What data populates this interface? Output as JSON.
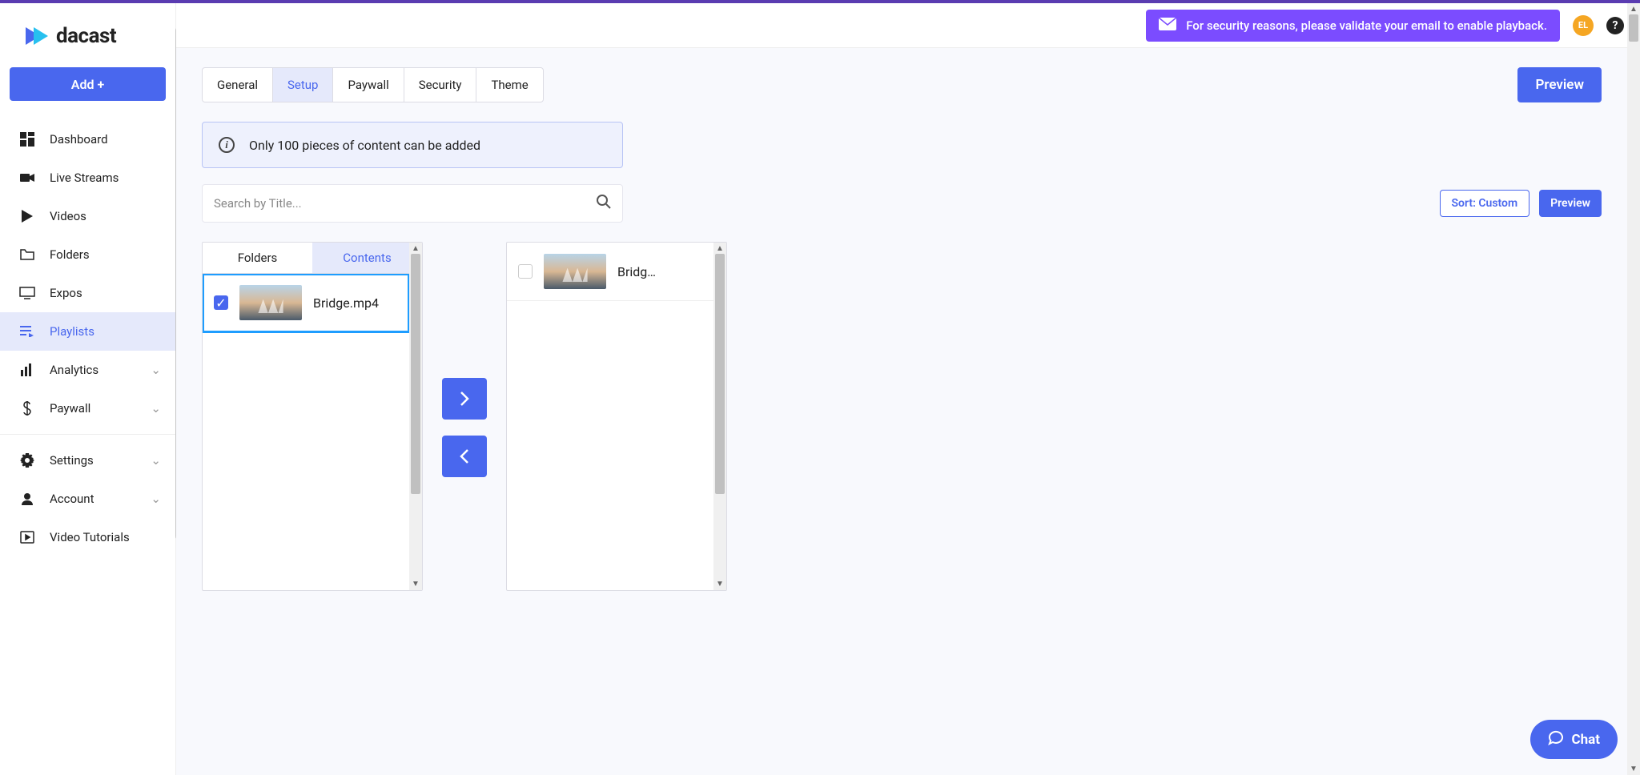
{
  "brand": {
    "name": "dacast"
  },
  "sidebar": {
    "add_label": "Add +",
    "items": [
      {
        "label": "Dashboard",
        "icon": "dashboard-icon"
      },
      {
        "label": "Live Streams",
        "icon": "camera-icon"
      },
      {
        "label": "Videos",
        "icon": "play-icon"
      },
      {
        "label": "Folders",
        "icon": "folder-icon"
      },
      {
        "label": "Expos",
        "icon": "monitor-icon"
      },
      {
        "label": "Playlists",
        "icon": "playlist-icon",
        "active": true
      },
      {
        "label": "Analytics",
        "icon": "bars-icon",
        "expandable": true
      },
      {
        "label": "Paywall",
        "icon": "dollar-icon",
        "expandable": true
      }
    ],
    "bottom": [
      {
        "label": "Settings",
        "icon": "gear-icon",
        "expandable": true
      },
      {
        "label": "Account",
        "icon": "person-icon",
        "expandable": true
      },
      {
        "label": "Video Tutorials",
        "icon": "video-tutorial-icon"
      }
    ]
  },
  "header": {
    "banner": "For security reasons, please validate your email to enable playback.",
    "avatar_initials": "EL"
  },
  "tabs": {
    "items": [
      "General",
      "Setup",
      "Paywall",
      "Security",
      "Theme"
    ],
    "active_index": 1,
    "preview_label": "Preview"
  },
  "info": {
    "text": "Only 100 pieces of content can be added"
  },
  "search": {
    "placeholder": "Search by Title..."
  },
  "actions": {
    "sort_label": "Sort: Custom",
    "preview_label": "Preview"
  },
  "picker": {
    "left_tabs": [
      "Folders",
      "Contents"
    ],
    "left_active_index": 1,
    "left_items": [
      {
        "name": "Bridge.mp4",
        "checked": true,
        "selected": true
      }
    ],
    "right_items": [
      {
        "name": "Bridg…",
        "checked": false
      }
    ]
  },
  "chat": {
    "label": "Chat"
  }
}
